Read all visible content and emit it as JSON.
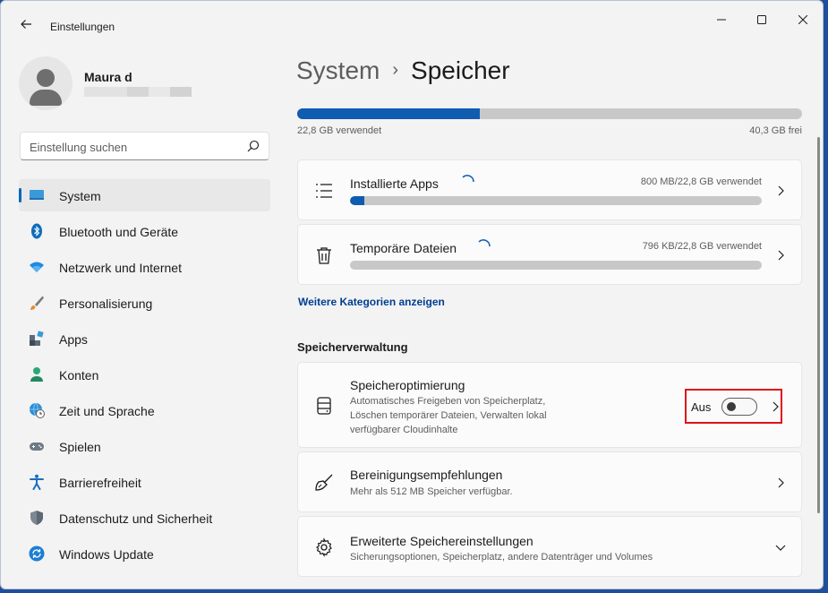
{
  "window": {
    "app_title": "Einstellungen"
  },
  "profile": {
    "name": "Maura d"
  },
  "search": {
    "placeholder": "Einstellung suchen"
  },
  "sidebar": {
    "items": [
      {
        "label": "System",
        "icon": "system-monitor-icon",
        "active": true
      },
      {
        "label": "Bluetooth und Geräte",
        "icon": "bluetooth-icon"
      },
      {
        "label": "Netzwerk und Internet",
        "icon": "wifi-icon"
      },
      {
        "label": "Personalisierung",
        "icon": "paintbrush-icon"
      },
      {
        "label": "Apps",
        "icon": "apps-icon"
      },
      {
        "label": "Konten",
        "icon": "account-icon"
      },
      {
        "label": "Zeit und Sprache",
        "icon": "globe-clock-icon"
      },
      {
        "label": "Spielen",
        "icon": "gamepad-icon"
      },
      {
        "label": "Barrierefreiheit",
        "icon": "accessibility-icon"
      },
      {
        "label": "Datenschutz und Sicherheit",
        "icon": "shield-icon"
      },
      {
        "label": "Windows Update",
        "icon": "update-icon"
      }
    ]
  },
  "header": {
    "breadcrumb_parent": "System",
    "breadcrumb_current": "Speicher"
  },
  "storage": {
    "used_fraction": 0.361,
    "used_text": "22,8 GB verwendet",
    "free_text": "40,3 GB frei"
  },
  "categories": [
    {
      "title": "Installierte Apps",
      "meta": "800 MB/22,8 GB verwendet",
      "fraction": 0.035,
      "icon": "list-icon"
    },
    {
      "title": "Temporäre Dateien",
      "meta": "796 KB/22,8 GB verwendet",
      "fraction": 0.0,
      "icon": "trash-icon"
    }
  ],
  "more_categories_link": "Weitere Kategorien anzeigen",
  "management": {
    "section_title": "Speicherverwaltung",
    "optimization": {
      "title": "Speicheroptimierung",
      "desc_line1": "Automatisches Freigeben von Speicherplatz,",
      "desc_line2": "Löschen temporärer Dateien, Verwalten lokal",
      "desc_line3": "verfügbarer Cloudinhalte",
      "toggle_label": "Aus",
      "toggle_on": false
    },
    "cleanup": {
      "title": "Bereinigungsempfehlungen",
      "desc": "Mehr als 512 MB Speicher verfügbar."
    },
    "advanced": {
      "title": "Erweiterte Speichereinstellungen",
      "desc": "Sicherungsoptionen, Speicherplatz, andere Datenträger und Volumes"
    }
  },
  "colors": {
    "accent": "#0067c0",
    "bar_fill": "#0f5cb0",
    "highlight": "#e0121c"
  }
}
